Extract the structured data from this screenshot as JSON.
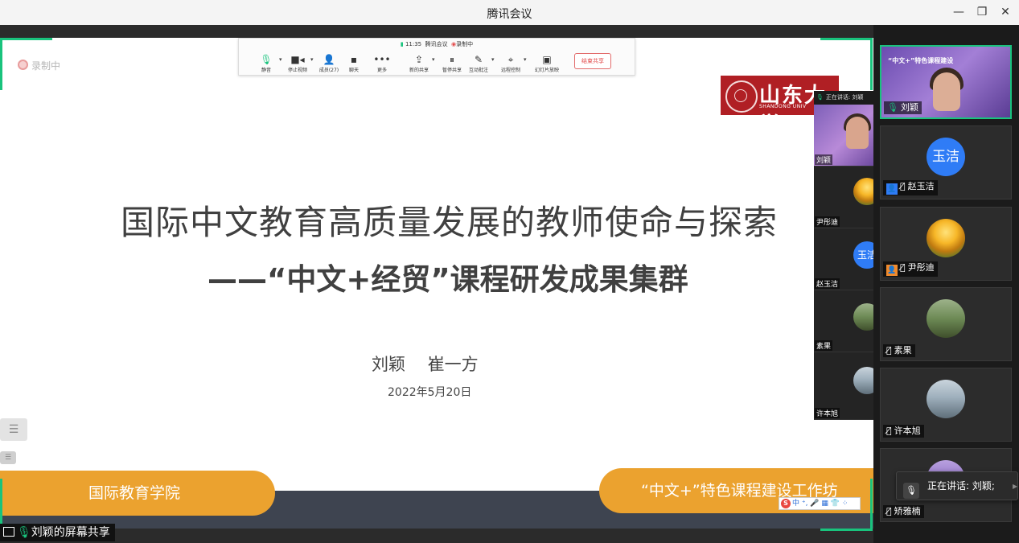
{
  "window": {
    "title": "腾讯会议",
    "controls": {
      "minimize": "—",
      "restore": "❐",
      "close": "✕"
    }
  },
  "toolbar": {
    "time": "11:35",
    "app_name": "腾讯会议",
    "recording_status": "录制中",
    "items": [
      {
        "label": "静音",
        "icon": "microphone-icon"
      },
      {
        "label": "停止视频",
        "icon": "video-camera-icon"
      },
      {
        "label": "成员(27)",
        "icon": "members-icon"
      },
      {
        "label": "聊天",
        "icon": "chat-icon"
      },
      {
        "label": "更多",
        "icon": "more-icon"
      },
      {
        "label": "新的共享",
        "icon": "new-share-icon"
      },
      {
        "label": "暂停共享",
        "icon": "pause-share-icon"
      },
      {
        "label": "互动批注",
        "icon": "annotate-icon"
      },
      {
        "label": "远程控制",
        "icon": "remote-control-icon"
      },
      {
        "label": "幻灯片放映",
        "icon": "slideshow-icon"
      }
    ],
    "end_share_label": "结束共享"
  },
  "stage": {
    "recording_label": "录制中",
    "share_label": "刘颖的屏幕共享"
  },
  "slide": {
    "logo": {
      "cn": "山东大学",
      "en": "SHANDONG UNIV"
    },
    "title": "国际中文教育高质量发展的教师使命与探索",
    "subtitle": "——“中文+经贸”课程研发成果集群",
    "authors": "刘颖　 崔一方",
    "date": "2022年5月20日",
    "footer_left": "国际教育学院",
    "footer_right": "“中文+”特色课程建设工作坊",
    "ime_text": "中 ⁺, 🎤 ▦ 👕 ⁘"
  },
  "mini_strip": {
    "speaking": "正在讲话: 刘颖",
    "participants": [
      {
        "name": "刘颖",
        "avatar": "video"
      },
      {
        "name": "尹彤迪",
        "avatar": "sunflower"
      },
      {
        "name": "赵玉洁",
        "avatar": "initials",
        "initials": "玉洁"
      },
      {
        "name": "素果",
        "avatar": "tree"
      },
      {
        "name": "许本旭",
        "avatar": "city"
      }
    ]
  },
  "participants": [
    {
      "name": "刘颖",
      "avatar": "video",
      "mic": "on",
      "active": true,
      "banner": "“中文+”特色课程建设"
    },
    {
      "name": "赵玉洁",
      "avatar": "initials",
      "initials": "玉洁",
      "mic": "off",
      "badge": "blue"
    },
    {
      "name": "尹彤迪",
      "avatar": "sunflower",
      "mic": "off",
      "badge": "orange"
    },
    {
      "name": "素果",
      "avatar": "tree",
      "mic": "off"
    },
    {
      "name": "许本旭",
      "avatar": "city",
      "mic": "off"
    },
    {
      "name": "矫雅楠",
      "avatar": "tower",
      "mic": "off"
    }
  ],
  "speaking_popup": "正在讲话: 刘颖;",
  "colors": {
    "accent_green": "#19c37d",
    "footer_orange": "#eba22f",
    "logo_red": "#b01f24",
    "record_red": "#e24b4b"
  }
}
